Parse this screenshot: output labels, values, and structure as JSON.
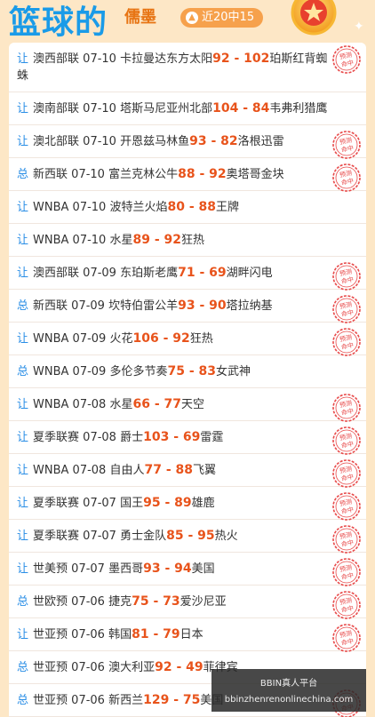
{
  "header": {
    "title": "篮球的",
    "author": "儒墨",
    "badge": "近20中15"
  },
  "stamp_text": "预测命中",
  "rows": [
    {
      "kind": "让",
      "league": "澳西部联",
      "date": "07-10",
      "home": "卡拉曼达东方太阳",
      "home_score": "92",
      "away_score": "102",
      "away": "珀斯红背蜘蛛",
      "hit": true
    },
    {
      "kind": "让",
      "league": "澳南部联",
      "date": "07-10",
      "home": "塔斯马尼亚州北部",
      "home_score": "104",
      "away_score": "84",
      "away": "韦弗利猎鹰",
      "hit": false
    },
    {
      "kind": "让",
      "league": "澳北部联",
      "date": "07-10",
      "home": "开恩兹马林鱼",
      "home_score": "93",
      "away_score": "82",
      "away": "洛根迅雷",
      "hit": true
    },
    {
      "kind": "总",
      "league": "新西联",
      "date": "07-10",
      "home": "富兰克林公牛",
      "home_score": "88",
      "away_score": "92",
      "away": "奥塔哥金块",
      "hit": true
    },
    {
      "kind": "让",
      "league": "WNBA",
      "date": "07-10",
      "home": "波特兰火焰",
      "home_score": "80",
      "away_score": "88",
      "away": "王牌",
      "hit": false
    },
    {
      "kind": "让",
      "league": "WNBA",
      "date": "07-10",
      "home": "水星",
      "home_score": "89",
      "away_score": "92",
      "away": "狂热",
      "hit": false
    },
    {
      "kind": "让",
      "league": "澳西部联",
      "date": "07-09",
      "home": "东珀斯老鹰",
      "home_score": "71",
      "away_score": "69",
      "away": "湖畔闪电",
      "hit": true
    },
    {
      "kind": "总",
      "league": "新西联",
      "date": "07-09",
      "home": "坎特伯雷公羊",
      "home_score": "93",
      "away_score": "90",
      "away": "塔拉纳基",
      "hit": true
    },
    {
      "kind": "让",
      "league": "WNBA",
      "date": "07-09",
      "home": "火花",
      "home_score": "106",
      "away_score": "92",
      "away": "狂热",
      "hit": true
    },
    {
      "kind": "总",
      "league": "WNBA",
      "date": "07-09",
      "home": "多伦多节奏",
      "home_score": "75",
      "away_score": "83",
      "away": "女武神",
      "hit": false
    },
    {
      "kind": "让",
      "league": "WNBA",
      "date": "07-08",
      "home": "水星",
      "home_score": "66",
      "away_score": "77",
      "away": "天空",
      "hit": true
    },
    {
      "kind": "让",
      "league": "夏季联赛",
      "date": "07-08",
      "home": "爵士",
      "home_score": "103",
      "away_score": "69",
      "away": "雷霆",
      "hit": true
    },
    {
      "kind": "让",
      "league": "WNBA",
      "date": "07-08",
      "home": "自由人",
      "home_score": "77",
      "away_score": "88",
      "away": "飞翼",
      "hit": true
    },
    {
      "kind": "让",
      "league": "夏季联赛",
      "date": "07-07",
      "home": "国王",
      "home_score": "95",
      "away_score": "89",
      "away": "雄鹿",
      "hit": true
    },
    {
      "kind": "让",
      "league": "夏季联赛",
      "date": "07-07",
      "home": "勇士金队",
      "home_score": "85",
      "away_score": "95",
      "away": "热火",
      "hit": true
    },
    {
      "kind": "让",
      "league": "世美预",
      "date": "07-07",
      "home": "墨西哥",
      "home_score": "93",
      "away_score": "94",
      "away": "美国",
      "hit": true
    },
    {
      "kind": "总",
      "league": "世欧预",
      "date": "07-06",
      "home": "捷克",
      "home_score": "75",
      "away_score": "73",
      "away": "爱沙尼亚",
      "hit": true
    },
    {
      "kind": "让",
      "league": "世亚预",
      "date": "07-06",
      "home": "韩国",
      "home_score": "81",
      "away_score": "79",
      "away": "日本",
      "hit": true
    },
    {
      "kind": "总",
      "league": "世亚预",
      "date": "07-06",
      "home": "澳大利亚",
      "home_score": "92",
      "away_score": "49",
      "away": "菲律宾",
      "hit": false
    },
    {
      "kind": "总",
      "league": "世亚预",
      "date": "07-06",
      "home": "新西兰",
      "home_score": "129",
      "away_score": "75",
      "away": "美国",
      "hit": true
    }
  ],
  "watermark": {
    "line1": "BBIN真人平台",
    "line2": "bbinzhenrenonlinechina.com"
  },
  "colors": {
    "accent": "#1a9be8",
    "score": "#e8531b",
    "stamp": "#e84a4a"
  }
}
